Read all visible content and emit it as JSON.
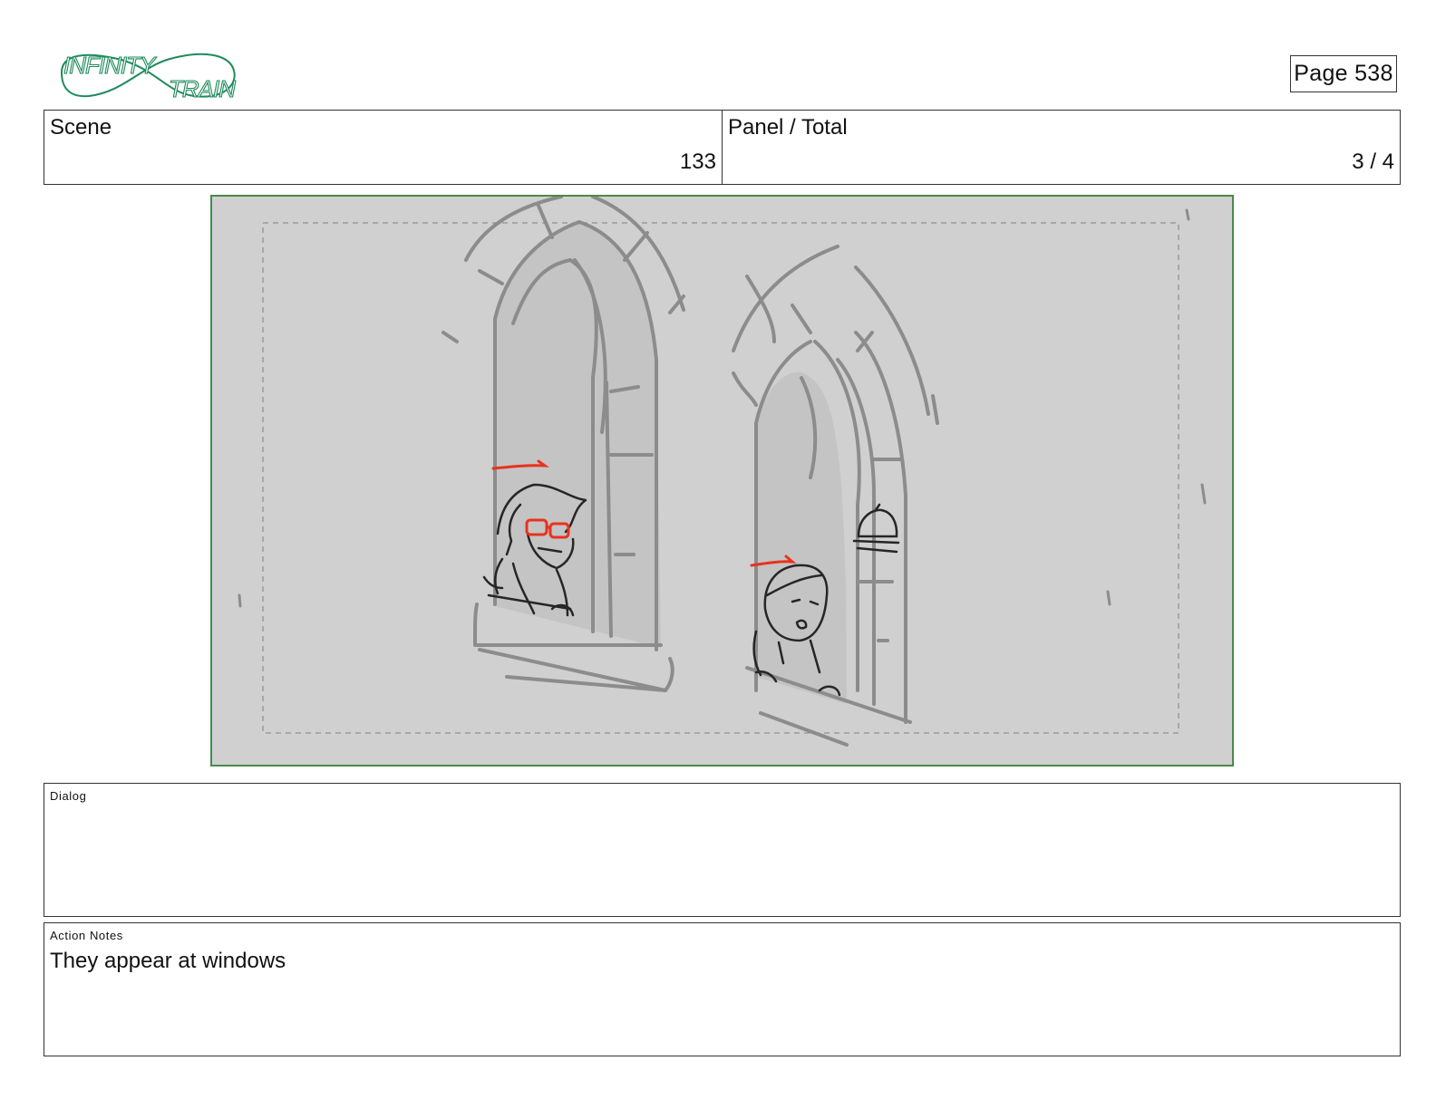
{
  "logo": {
    "line1": "INFINITY",
    "line2": "TRAIN"
  },
  "page": {
    "label": "Page 538"
  },
  "header": {
    "scene_label": "Scene",
    "scene_value": "133",
    "panel_label": "Panel / Total",
    "panel_value": "3 / 4"
  },
  "dialog": {
    "label": "Dialog",
    "text": ""
  },
  "action_notes": {
    "label": "Action Notes",
    "text": "They appear at windows"
  },
  "colors": {
    "logo": "#1e8a5c",
    "panel_border": "#4a8a4a",
    "panel_bg": "#d0d0d0",
    "marker": "#e8321e"
  }
}
